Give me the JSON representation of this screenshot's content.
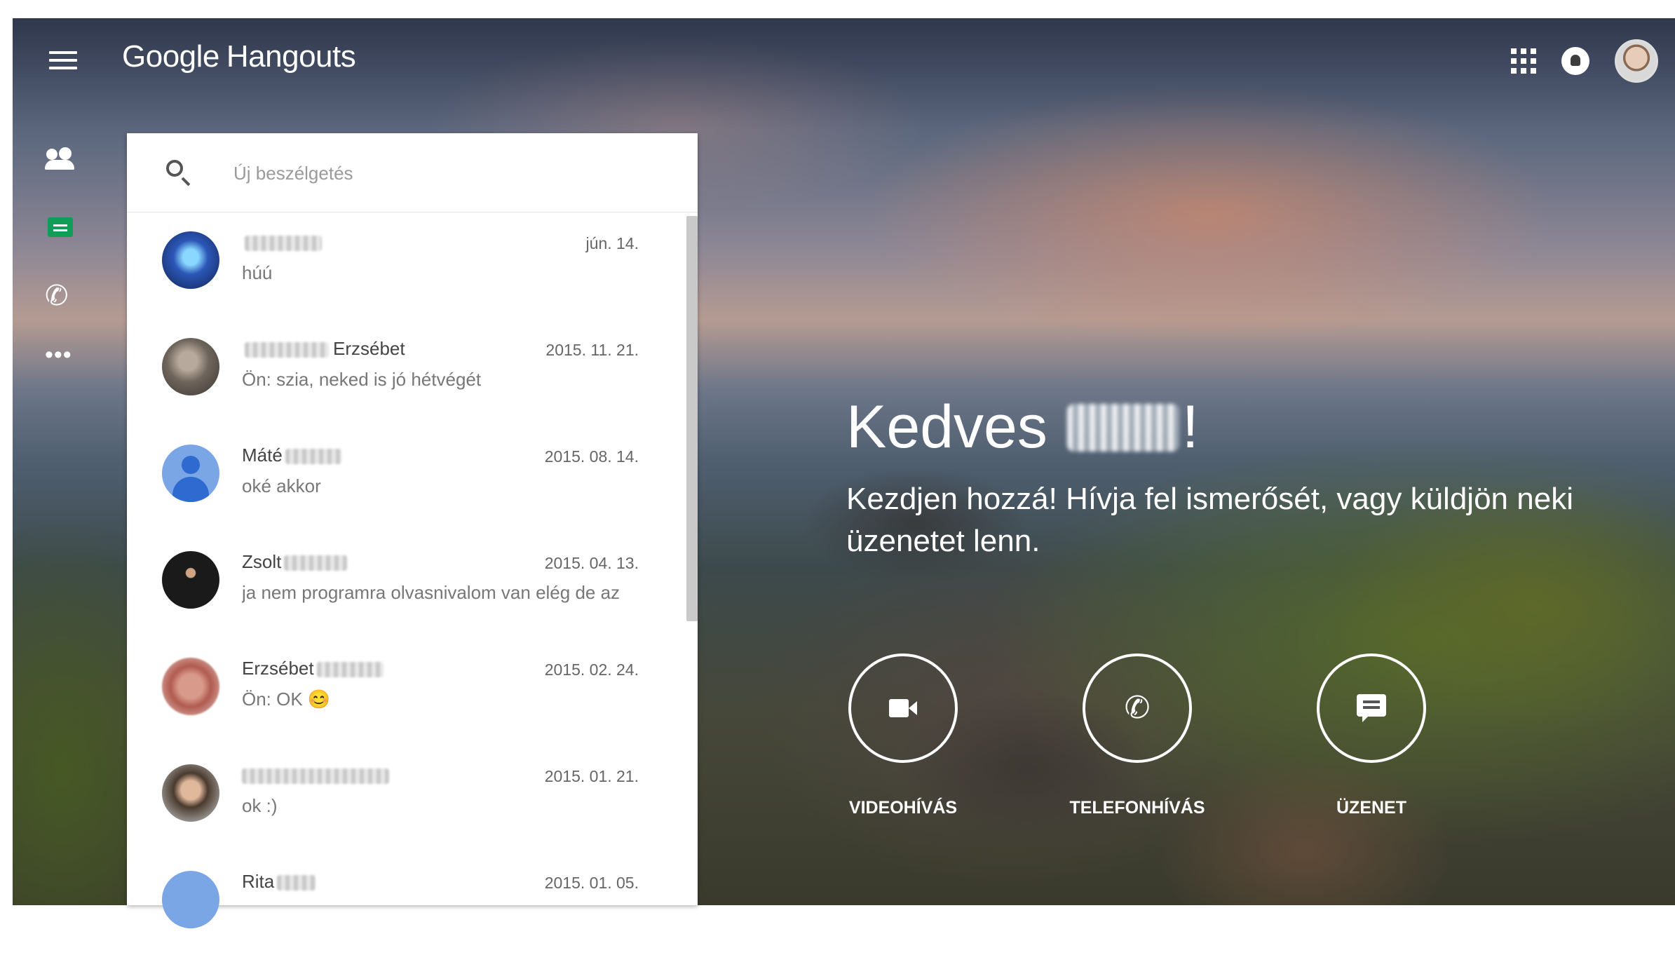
{
  "app": {
    "brand_google": "Google",
    "brand_hangouts": "Hangouts"
  },
  "topbar": {
    "icons": [
      "menu-icon",
      "apps-grid-icon",
      "notifications-icon",
      "account-avatar"
    ]
  },
  "rail": {
    "items": [
      "people-icon",
      "chat-icon",
      "phone-icon",
      "more-icon"
    ],
    "active_color": "#0f9d58"
  },
  "search": {
    "placeholder": "Új beszélgetés"
  },
  "conversations": [
    {
      "name": "",
      "date": "jún. 14.",
      "message": "húú"
    },
    {
      "name": "Erzsébet",
      "date": "2015. 11. 21.",
      "message": "Ön: szia, neked is jó hétvégét"
    },
    {
      "name": "Máté",
      "date": "2015. 08. 14.",
      "message": "oké akkor"
    },
    {
      "name": "Zsolt",
      "date": "2015. 04. 13.",
      "message": "ja nem programra olvasnivalom van elég de az"
    },
    {
      "name": "Erzsébet",
      "date": "2015. 02. 24.",
      "message": "Ön: OK 😊"
    },
    {
      "name": "",
      "date": "2015. 01. 21.",
      "message": "ok :)"
    },
    {
      "name": "Rita",
      "date": "2015. 01. 05.",
      "message": ""
    }
  ],
  "welcome": {
    "greeting": "Kedves",
    "exclamation": "!",
    "subtitle": "Kezdjen hozzá! Hívja fel ismerősét, vagy küldjön neki üzenetet lenn."
  },
  "actions": [
    {
      "label": "VIDEOHÍVÁS",
      "icon": "video-camera-icon"
    },
    {
      "label": "TELEFONHÍVÁS",
      "icon": "phone-icon"
    },
    {
      "label": "ÜZENET",
      "icon": "message-icon"
    }
  ]
}
